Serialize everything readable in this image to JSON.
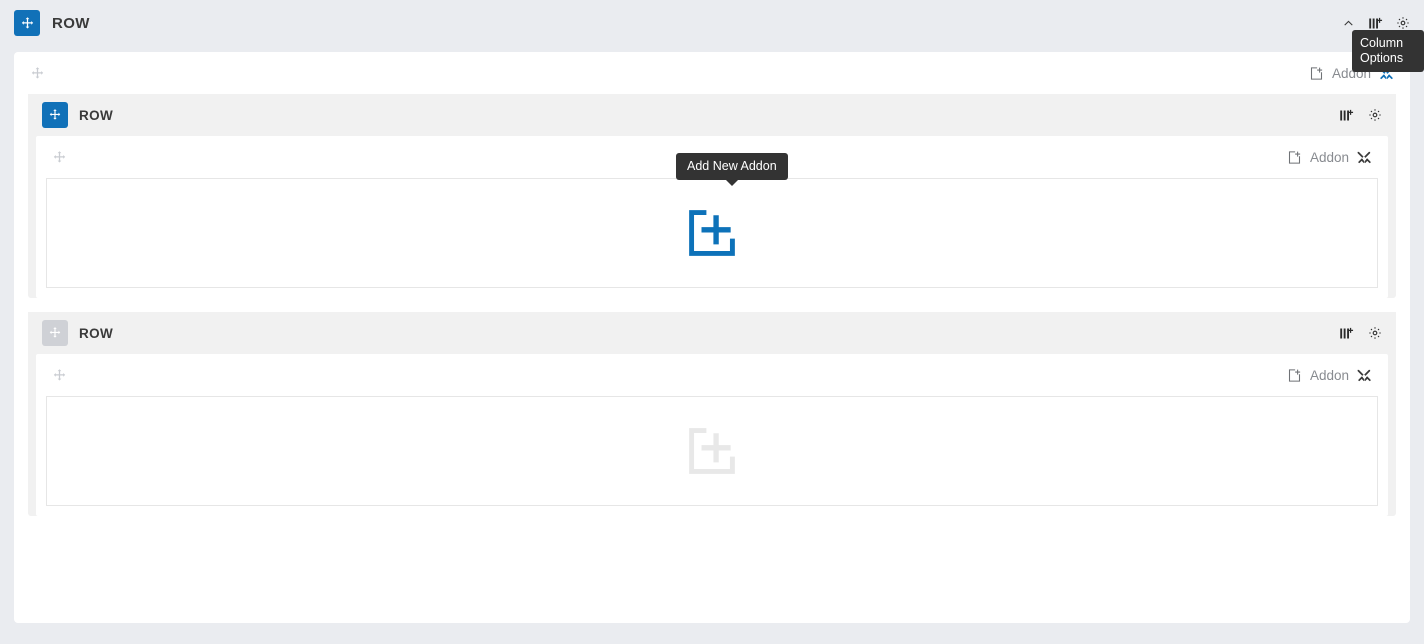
{
  "page": {
    "background_color": "#eaecf0",
    "panel_color": "#ffffff",
    "accent_color": "#1171b8",
    "muted_color": "#cfd1d6",
    "tooltip_background": "#333333"
  },
  "top_bar": {
    "title": "ROW",
    "move_handle_icon": "move-arrows-icon",
    "actions": [
      {
        "name": "collapse-icon",
        "icon": "chevron-up-icon"
      },
      {
        "name": "column-options-icon",
        "icon": "add-column-icon"
      },
      {
        "name": "row-settings-icon",
        "icon": "gear-icon"
      }
    ],
    "tooltip": {
      "line1": "Column",
      "line2": "Options"
    }
  },
  "outer_column": {
    "drag_handle_icon": "move-arrows-icon",
    "addon_label": "Addon",
    "add_addon_icon": "add-file-icon",
    "tools_icon": "tools-icon",
    "tools_icon_color": "#1171b8"
  },
  "rows": [
    {
      "title": "ROW",
      "state": "active",
      "move_handle_color": "#1171b8",
      "actions": [
        {
          "name": "column-options-icon",
          "icon": "add-column-icon"
        },
        {
          "name": "row-settings-icon",
          "icon": "gear-icon"
        }
      ],
      "column": {
        "drag_handle_icon": "move-arrows-icon",
        "addon_label": "Addon",
        "add_addon_icon": "add-file-icon",
        "tools_icon": "tools-icon",
        "tools_icon_color": "#3a3a3a"
      },
      "dropzone": {
        "add_icon": "add-addon-icon",
        "add_icon_color": "#1171b8",
        "tooltip": "Add New Addon"
      }
    },
    {
      "title": "ROW",
      "state": "inactive",
      "move_handle_color": "#cfd1d6",
      "actions": [
        {
          "name": "column-options-icon",
          "icon": "add-column-icon"
        },
        {
          "name": "row-settings-icon",
          "icon": "gear-icon"
        }
      ],
      "column": {
        "drag_handle_icon": "move-arrows-icon",
        "addon_label": "Addon",
        "add_addon_icon": "add-file-icon",
        "tools_icon": "tools-icon",
        "tools_icon_color": "#3a3a3a"
      },
      "dropzone": {
        "add_icon": "add-addon-icon",
        "add_icon_color": "#e8e8e8",
        "tooltip": ""
      }
    }
  ]
}
